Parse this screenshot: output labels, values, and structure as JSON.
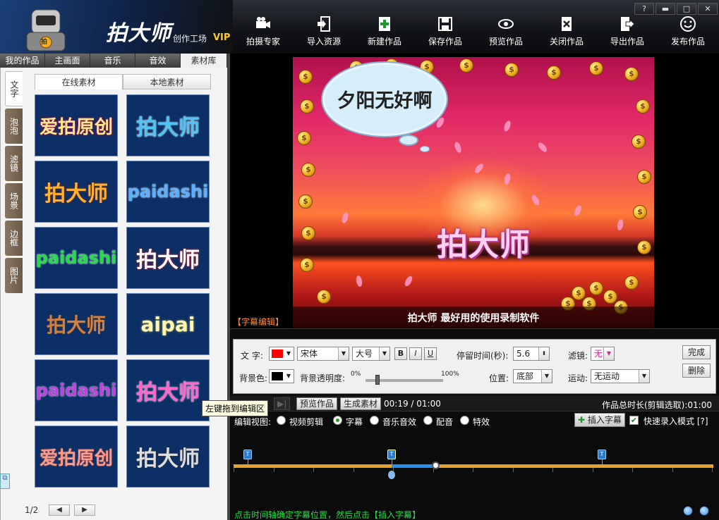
{
  "window": {
    "help_label": "?",
    "minimize_label": "▬",
    "maximize_label": "□",
    "close_label": "✕"
  },
  "brand": {
    "name": "拍大师",
    "sub": "创作工场",
    "vip": "VIP",
    "badge": "拍"
  },
  "toolbar": [
    {
      "label": "拍摄专家",
      "icon": "camera-icon"
    },
    {
      "label": "导入资源",
      "icon": "import-icon"
    },
    {
      "label": "新建作品",
      "icon": "new-icon"
    },
    {
      "label": "保存作品",
      "icon": "save-icon"
    },
    {
      "label": "预览作品",
      "icon": "eye-icon"
    },
    {
      "label": "关闭作品",
      "icon": "close-doc-icon"
    },
    {
      "label": "导出作品",
      "icon": "export-icon"
    },
    {
      "label": "发布作品",
      "icon": "smile-icon"
    }
  ],
  "main_tabs": [
    {
      "label": "我的作品"
    },
    {
      "label": "主画面"
    },
    {
      "label": "音乐"
    },
    {
      "label": "音效"
    },
    {
      "label": "素材库",
      "active": true
    }
  ],
  "side_tabs": [
    {
      "label": "文字",
      "active": true
    },
    {
      "label": "泡泡"
    },
    {
      "label": "滤镜"
    },
    {
      "label": "场景"
    },
    {
      "label": "边框"
    },
    {
      "label": "图片"
    }
  ],
  "source_tabs": [
    {
      "label": "在线素材",
      "active": true
    },
    {
      "label": "本地素材"
    }
  ],
  "tiles": [
    {
      "text": "爱拍原创"
    },
    {
      "text": "拍大师"
    },
    {
      "text": "拍大师"
    },
    {
      "text": "paidashi"
    },
    {
      "text": "paidashi"
    },
    {
      "text": "拍大师"
    },
    {
      "text": "拍大师"
    },
    {
      "text": "aipai"
    },
    {
      "text": "paidashi"
    },
    {
      "text": "拍大师"
    },
    {
      "text": "爱拍原创"
    },
    {
      "text": "拍大师"
    }
  ],
  "tooltip": "左键拖到编辑区",
  "pager": {
    "page": "1/2",
    "prev": "◀",
    "next": "▶"
  },
  "preview": {
    "bubble_text": "夕阳无好啊",
    "title_overlay": "拍大师",
    "caption": "拍大师  最好用的使用录制软件",
    "coin_symbol": "$"
  },
  "subtitle_edit_label": "【字幕编辑】",
  "editor": {
    "text_label": "文  字:",
    "text_color": "#ff0000",
    "font": "宋体",
    "size": "大号",
    "bold": "B",
    "italic": "I",
    "underline": "U",
    "duration_label": "停留时间(秒):",
    "duration_value": "5.6",
    "filter_label": "滤镜:",
    "filter_value": "无",
    "done_label": "完成",
    "delete_label": "删除",
    "bg_label": "背景色:",
    "bg_color": "#000000",
    "opacity_label": "背景透明度:",
    "opacity_min": "0%",
    "opacity_max": "100%",
    "opacity_value": 0.15,
    "position_label": "位置:",
    "position_value": "底部",
    "motion_label": "运动:",
    "motion_value": "无运动",
    "dropdown_arrow": "▼",
    "spin_arrow": "⬍"
  },
  "timeline": {
    "play_icon": "▶|",
    "preview_btn": "预览作品",
    "generate_btn": "生成素材",
    "time": "00:19 / 01:00",
    "total": "作品总时长(剪辑选取):01:00",
    "view_label": "编辑视图:",
    "views": [
      {
        "label": "视频剪辑",
        "on": false
      },
      {
        "label": "字幕",
        "on": true
      },
      {
        "label": "音乐音效",
        "on": false
      },
      {
        "label": "配音",
        "on": false
      },
      {
        "label": "特效",
        "on": false
      }
    ],
    "insert_btn": "插入字幕",
    "insert_plus": "✚",
    "fast_mode": "快速录入模式 [?]",
    "fast_checked": "✔",
    "marker_symbol": "T",
    "hint": "点击时间轴确定字幕位置，然后点击【插入字幕】"
  },
  "edge_icon": "⧉"
}
